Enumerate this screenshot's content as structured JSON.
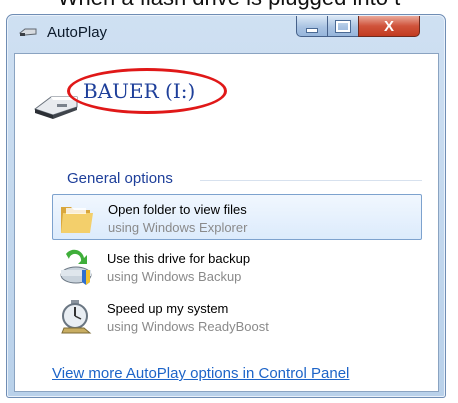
{
  "caption": {
    "text": "When a flash drive is plugged into t"
  },
  "window": {
    "title": "AutoPlay",
    "close_glyph": "X"
  },
  "drive": {
    "label": "BAUER (I:)"
  },
  "general_options": {
    "heading": "General options",
    "items": [
      {
        "title": "Open folder to view files",
        "subtitle": "using Windows Explorer",
        "icon": "folder-icon",
        "selected": true
      },
      {
        "title": "Use this drive for backup",
        "subtitle": "using Windows Backup",
        "icon": "backup-icon",
        "selected": false
      },
      {
        "title": "Speed up my system",
        "subtitle": "using Windows ReadyBoost",
        "icon": "stopwatch-icon",
        "selected": false
      }
    ]
  },
  "footer": {
    "link_text": "View more AutoPlay options in Control Panel"
  },
  "colors": {
    "heading_blue": "#1e3f9a",
    "link_blue": "#1d64c8",
    "annotation_red": "#e01818",
    "close_red": "#c23b20"
  }
}
